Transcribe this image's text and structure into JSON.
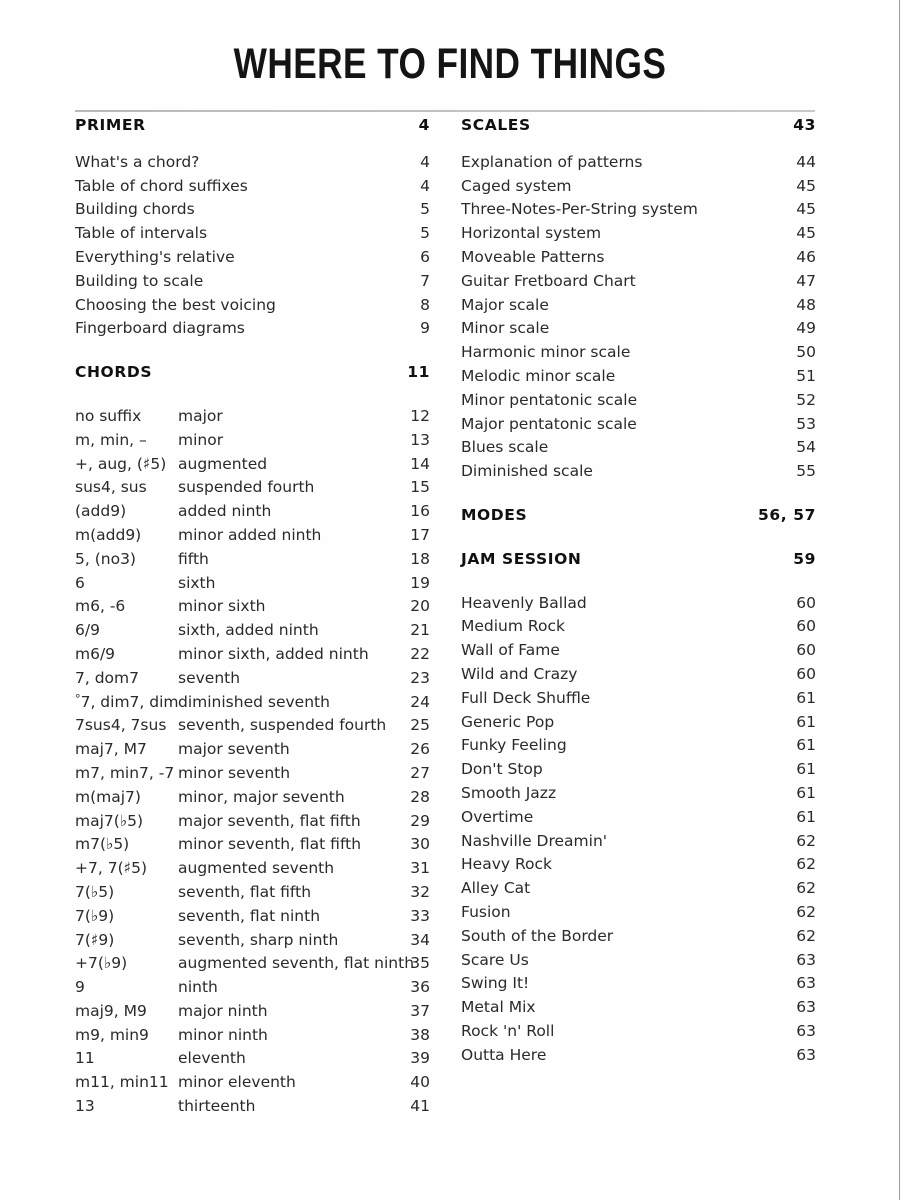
{
  "page": {
    "title": "WHERE TO FIND THINGS"
  },
  "left_column": {
    "primer": {
      "heading": "PRIMER",
      "heading_page": "4",
      "items": [
        {
          "label": "What's a chord?",
          "page": "4"
        },
        {
          "label": "Table of chord suffixes",
          "page": "4"
        },
        {
          "label": "Building chords",
          "page": "5"
        },
        {
          "label": "Table of intervals",
          "page": "5"
        },
        {
          "label": "Everything's relative",
          "page": "6"
        },
        {
          "label": "Building to scale",
          "page": "7"
        },
        {
          "label": "Choosing the best voicing",
          "page": "8"
        },
        {
          "label": "Fingerboard diagrams",
          "page": "9"
        }
      ]
    },
    "chords": {
      "heading": "CHORDS",
      "heading_page": "11",
      "items": [
        {
          "suffix": "no suffix",
          "desc": "major",
          "page": "12"
        },
        {
          "suffix": "m, min, –",
          "desc": "minor",
          "page": "13"
        },
        {
          "suffix": "+, aug, (♯5)",
          "desc": "augmented",
          "page": "14"
        },
        {
          "suffix": "sus4, sus",
          "desc": "suspended fourth",
          "page": "15"
        },
        {
          "suffix": "(add9)",
          "desc": "added ninth",
          "page": "16"
        },
        {
          "suffix": "m(add9)",
          "desc": "minor added ninth",
          "page": "17"
        },
        {
          "suffix": "5, (no3)",
          "desc": "fifth",
          "page": "18"
        },
        {
          "suffix": "6",
          "desc": "sixth",
          "page": "19"
        },
        {
          "suffix": "m6, -6",
          "desc": "minor sixth",
          "page": "20"
        },
        {
          "suffix": "6/9",
          "desc": "sixth, added ninth",
          "page": "21"
        },
        {
          "suffix": "m6/9",
          "desc": "minor sixth, added ninth",
          "page": "22"
        },
        {
          "suffix": "7, dom7",
          "desc": "seventh",
          "page": "23"
        },
        {
          "suffix": "°7, dim7, dim",
          "desc": "diminished seventh",
          "page": "24"
        },
        {
          "suffix": "7sus4, 7sus",
          "desc": "seventh, suspended fourth",
          "page": "25"
        },
        {
          "suffix": "maj7, M7",
          "desc": "major seventh",
          "page": "26"
        },
        {
          "suffix": "m7, min7, -7",
          "desc": "minor seventh",
          "page": "27"
        },
        {
          "suffix": "m(maj7)",
          "desc": "minor, major seventh",
          "page": "28"
        },
        {
          "suffix": "maj7(♭5)",
          "desc": "major seventh, flat fifth",
          "page": "29"
        },
        {
          "suffix": "m7(♭5)",
          "desc": "minor seventh, flat fifth",
          "page": "30"
        },
        {
          "suffix": "+7, 7(♯5)",
          "desc": "augmented seventh",
          "page": "31"
        },
        {
          "suffix": "7(♭5)",
          "desc": "seventh, flat fifth",
          "page": "32"
        },
        {
          "suffix": "7(♭9)",
          "desc": "seventh, flat ninth",
          "page": "33"
        },
        {
          "suffix": "7(♯9)",
          "desc": "seventh, sharp ninth",
          "page": "34"
        },
        {
          "suffix": "+7(♭9)",
          "desc": "augmented seventh, flat ninth",
          "page": "35"
        },
        {
          "suffix": "9",
          "desc": "ninth",
          "page": "36"
        },
        {
          "suffix": "maj9, M9",
          "desc": "major ninth",
          "page": "37"
        },
        {
          "suffix": "m9, min9",
          "desc": "minor ninth",
          "page": "38"
        },
        {
          "suffix": "11",
          "desc": "eleventh",
          "page": "39"
        },
        {
          "suffix": "m11, min11",
          "desc": "minor eleventh",
          "page": "40"
        },
        {
          "suffix": "13",
          "desc": "thirteenth",
          "page": "41"
        }
      ]
    }
  },
  "right_column": {
    "scales": {
      "heading": "SCALES",
      "heading_page": "43",
      "items": [
        {
          "label": "Explanation of patterns",
          "page": "44"
        },
        {
          "label": "Caged system",
          "page": "45"
        },
        {
          "label": "Three-Notes-Per-String system",
          "page": "45"
        },
        {
          "label": "Horizontal system",
          "page": "45"
        },
        {
          "label": "Moveable Patterns",
          "page": "46"
        },
        {
          "label": "Guitar Fretboard Chart",
          "page": "47"
        },
        {
          "label": "Major scale",
          "page": "48"
        },
        {
          "label": "Minor scale",
          "page": "49"
        },
        {
          "label": "Harmonic minor scale",
          "page": "50"
        },
        {
          "label": "Melodic minor scale",
          "page": "51"
        },
        {
          "label": "Minor pentatonic scale",
          "page": "52"
        },
        {
          "label": "Major pentatonic scale",
          "page": "53"
        },
        {
          "label": "Blues scale",
          "page": "54"
        },
        {
          "label": "Diminished scale",
          "page": "55"
        }
      ]
    },
    "modes": {
      "heading": "MODES",
      "heading_page": "56, 57"
    },
    "jam_session": {
      "heading": "JAM SESSION",
      "heading_page": "59",
      "items": [
        {
          "label": "Heavenly Ballad",
          "page": "60"
        },
        {
          "label": "Medium Rock",
          "page": "60"
        },
        {
          "label": "Wall of Fame",
          "page": "60"
        },
        {
          "label": "Wild and Crazy",
          "page": "60"
        },
        {
          "label": "Full Deck Shuffle",
          "page": "61"
        },
        {
          "label": "Generic Pop",
          "page": "61"
        },
        {
          "label": "Funky Feeling",
          "page": "61"
        },
        {
          "label": "Don't Stop",
          "page": "61"
        },
        {
          "label": "Smooth Jazz",
          "page": "61"
        },
        {
          "label": "Overtime",
          "page": "61"
        },
        {
          "label": "Nashville Dreamin'",
          "page": "62"
        },
        {
          "label": "Heavy Rock",
          "page": "62"
        },
        {
          "label": "Alley Cat",
          "page": "62"
        },
        {
          "label": "Fusion",
          "page": "62"
        },
        {
          "label": "South of the Border",
          "page": "62"
        },
        {
          "label": "Scare Us",
          "page": "63"
        },
        {
          "label": "Swing It!",
          "page": "63"
        },
        {
          "label": "Metal Mix",
          "page": "63"
        },
        {
          "label": "Rock 'n' Roll",
          "page": "63"
        },
        {
          "label": "Outta Here",
          "page": "63"
        }
      ]
    }
  }
}
